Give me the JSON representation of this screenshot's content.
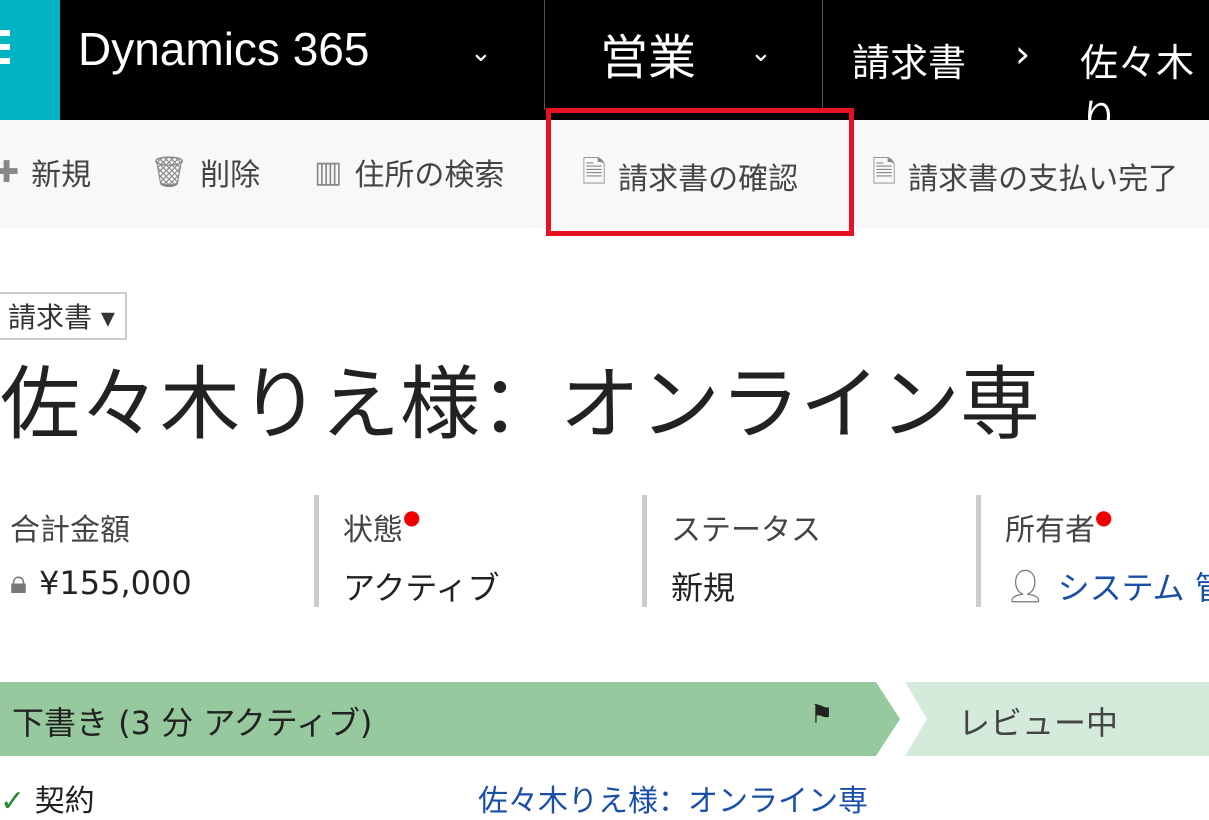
{
  "nav": {
    "app": "Dynamics 365",
    "module": "営業",
    "breadcrumb": [
      "請求書",
      "佐々木り"
    ]
  },
  "commands": [
    {
      "label": "新規",
      "icon": "plus-icon"
    },
    {
      "label": "削除",
      "icon": "trash-icon"
    },
    {
      "label": "住所の検索",
      "icon": "address-book-icon"
    },
    {
      "label": "請求書の確認",
      "icon": "document-check-icon"
    },
    {
      "label": "請求書の支払い完了",
      "icon": "document-check-icon"
    }
  ],
  "entity": {
    "selector": "請求書 ▾",
    "title": "佐々木りえ様：オンライン専"
  },
  "fields": [
    {
      "label": "合計金額",
      "value": "¥155,000"
    },
    {
      "label": "状態",
      "value": "アクティブ"
    },
    {
      "label": "ステータス",
      "value": "新規"
    },
    {
      "label": "所有者",
      "value": "システム 管"
    }
  ],
  "process": {
    "active_stage": "下書き (3 分 アクティブ)",
    "next_stage": "レビュー中"
  },
  "bottom": {
    "left": "契約",
    "link": "佐々木りえ様：オンライン専"
  },
  "colors": {
    "highlight": "#e81123",
    "accent": "#00b4c4",
    "stage": "#96c99d"
  }
}
